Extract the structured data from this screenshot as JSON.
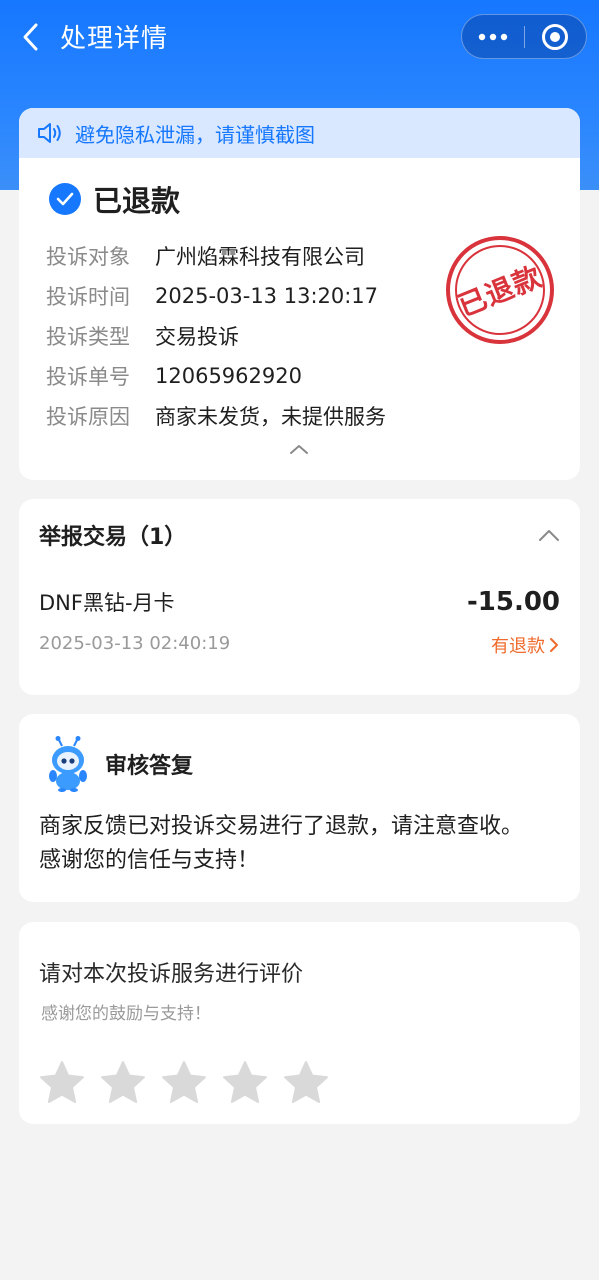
{
  "nav": {
    "title": "处理详情",
    "back_icon": "back-chevron-icon",
    "more_icon": "more-dots-icon",
    "close_icon": "target-close-icon"
  },
  "notice": {
    "icon": "speaker-icon",
    "text": "避免隐私泄漏，请谨慎截图"
  },
  "status": {
    "icon": "check-circle-icon",
    "text": "已退款",
    "stamp": "已退款"
  },
  "info": [
    {
      "label": "投诉对象",
      "value": "广州焰霖科技有限公司"
    },
    {
      "label": "投诉时间",
      "value": "2025-03-13 13:20:17"
    },
    {
      "label": "投诉类型",
      "value": "交易投诉"
    },
    {
      "label": "投诉单号",
      "value": "12065962920"
    },
    {
      "label": "投诉原因",
      "value": "商家未发货，未提供服务"
    }
  ],
  "transactions": {
    "title": "举报交易（1）",
    "items": [
      {
        "name": "DNF黑钻-月卡",
        "amount": "-15.00",
        "time": "2025-03-13 02:40:19",
        "status": "有退款"
      }
    ]
  },
  "reply": {
    "title": "审核答复",
    "body": "商家反馈已对投诉交易进行了退款，请注意查收。感谢您的信任与支持！"
  },
  "rating": {
    "title": "请对本次投诉服务进行评价",
    "subtitle": "感谢您的鼓励与支持！",
    "stars_total": 5,
    "stars_selected": 0
  },
  "colors": {
    "brand_blue": "#1677ff",
    "stamp_red": "#d9333c",
    "refund_orange": "#f06a2b"
  }
}
